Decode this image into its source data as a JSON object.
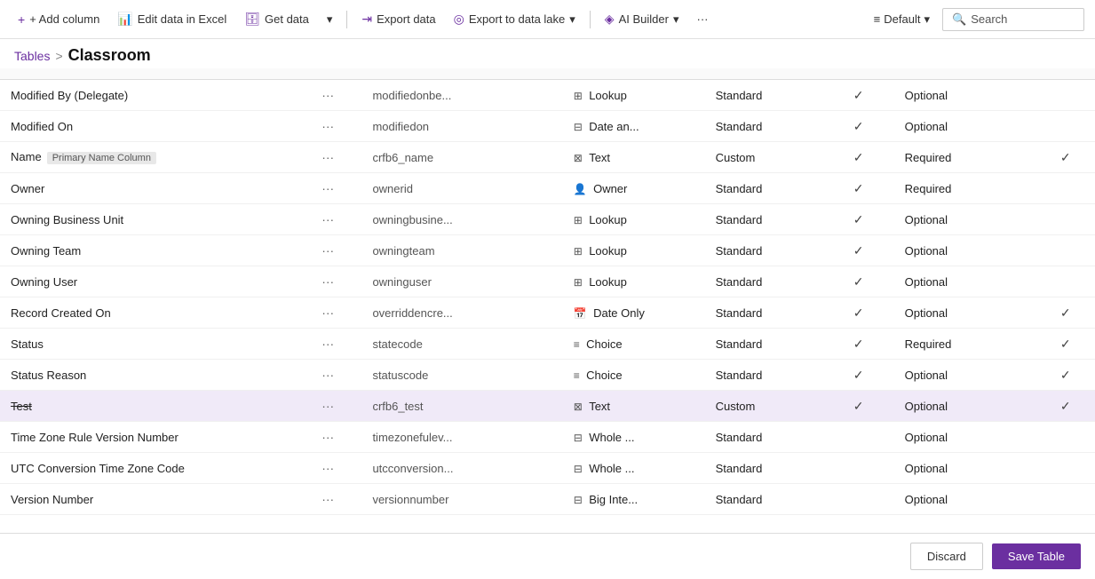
{
  "toolbar": {
    "add_column": "+ Add column",
    "edit_excel": "Edit data in Excel",
    "get_data": "Get data",
    "export_data": "Export data",
    "export_lake": "Export to data lake",
    "ai_builder": "AI Builder",
    "more": "···",
    "default": "Default",
    "search": "Search"
  },
  "breadcrumb": {
    "tables": "Tables",
    "separator": ">",
    "current": "Classroom"
  },
  "table": {
    "columns": [],
    "rows": [
      {
        "name": "Modified By (Delegate)",
        "strikethrough": false,
        "primary_badge": false,
        "logical": "modifiedonbe...",
        "type_icon": "⊞",
        "type": "Lookup",
        "managed": "Standard",
        "check1": true,
        "requirement": "Optional",
        "check2": false
      },
      {
        "name": "Modified On",
        "strikethrough": false,
        "primary_badge": false,
        "logical": "modifiedon",
        "type_icon": "⊟",
        "type": "Date an...",
        "managed": "Standard",
        "check1": true,
        "requirement": "Optional",
        "check2": false
      },
      {
        "name": "Name",
        "strikethrough": false,
        "primary_badge": true,
        "primary_badge_text": "Primary Name Column",
        "logical": "crfb6_name",
        "type_icon": "⊠",
        "type": "Text",
        "managed": "Custom",
        "check1": true,
        "requirement": "Required",
        "check2": true
      },
      {
        "name": "Owner",
        "strikethrough": false,
        "primary_badge": false,
        "logical": "ownerid",
        "type_icon": "👤",
        "type": "Owner",
        "managed": "Standard",
        "check1": true,
        "requirement": "Required",
        "check2": false
      },
      {
        "name": "Owning Business Unit",
        "strikethrough": false,
        "primary_badge": false,
        "logical": "owningbusine...",
        "type_icon": "⊞",
        "type": "Lookup",
        "managed": "Standard",
        "check1": true,
        "requirement": "Optional",
        "check2": false
      },
      {
        "name": "Owning Team",
        "strikethrough": false,
        "primary_badge": false,
        "logical": "owningteam",
        "type_icon": "⊞",
        "type": "Lookup",
        "managed": "Standard",
        "check1": true,
        "requirement": "Optional",
        "check2": false
      },
      {
        "name": "Owning User",
        "strikethrough": false,
        "primary_badge": false,
        "logical": "owninguser",
        "type_icon": "⊞",
        "type": "Lookup",
        "managed": "Standard",
        "check1": true,
        "requirement": "Optional",
        "check2": false
      },
      {
        "name": "Record Created On",
        "strikethrough": false,
        "primary_badge": false,
        "logical": "overriddencrе...",
        "type_icon": "📅",
        "type": "Date Only",
        "managed": "Standard",
        "check1": true,
        "requirement": "Optional",
        "check2": true
      },
      {
        "name": "Status",
        "strikethrough": false,
        "primary_badge": false,
        "logical": "statecode",
        "type_icon": "≡",
        "type": "Choice",
        "managed": "Standard",
        "check1": true,
        "requirement": "Required",
        "check2": true
      },
      {
        "name": "Status Reason",
        "strikethrough": false,
        "primary_badge": false,
        "logical": "statuscode",
        "type_icon": "≡",
        "type": "Choice",
        "managed": "Standard",
        "check1": true,
        "requirement": "Optional",
        "check2": true
      },
      {
        "name": "Test",
        "strikethrough": true,
        "primary_badge": false,
        "logical": "crfb6_test",
        "type_icon": "⊠",
        "type": "Text",
        "managed": "Custom",
        "check1": true,
        "requirement": "Optional",
        "check2": true,
        "highlighted": true
      },
      {
        "name": "Time Zone Rule Version Number",
        "strikethrough": false,
        "primary_badge": false,
        "logical": "timezonefulev...",
        "type_icon": "⊟",
        "type": "Whole ...",
        "managed": "Standard",
        "check1": false,
        "requirement": "Optional",
        "check2": false
      },
      {
        "name": "UTC Conversion Time Zone Code",
        "strikethrough": false,
        "primary_badge": false,
        "logical": "utcconversion...",
        "type_icon": "⊟",
        "type": "Whole ...",
        "managed": "Standard",
        "check1": false,
        "requirement": "Optional",
        "check2": false
      },
      {
        "name": "Version Number",
        "strikethrough": false,
        "primary_badge": false,
        "logical": "versionnumber",
        "type_icon": "⊟",
        "type": "Big Inte...",
        "managed": "Standard",
        "check1": false,
        "requirement": "Optional",
        "check2": false
      }
    ]
  },
  "footer": {
    "discard": "Discard",
    "save": "Save Table"
  },
  "icons": {
    "add": "+",
    "excel": "📊",
    "data": "🗄",
    "export": "→",
    "lake": "🌊",
    "ai": "🤖",
    "chevron_down": "▾",
    "search": "🔍",
    "default_icon": "≡"
  }
}
